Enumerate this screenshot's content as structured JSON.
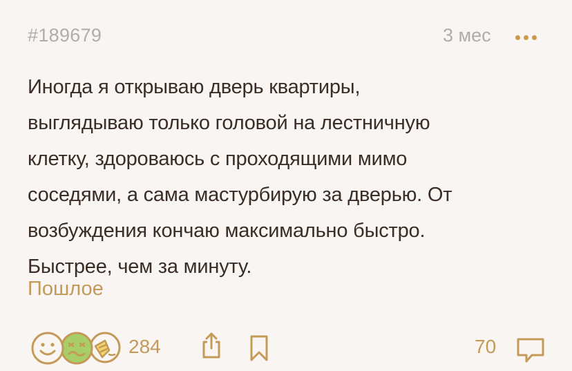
{
  "post": {
    "id": "#189679",
    "age": "3 мес",
    "text_lines": [
      "Иногда я открываю дверь квартиры,",
      "выглядываю только головой на лестничную",
      "клетку, здороваюсь с проходящими мимо",
      "соседями, а сама мастурбирую за дверью. От",
      "возбуждения кончаю максимально быстро.",
      "Быстрее, чем за минуту."
    ],
    "tag": "Пошлое"
  },
  "footer": {
    "reactions_count": "284",
    "comments_count": "70",
    "reaction_icons": [
      "smile-emoji-icon",
      "sick-emoji-icon",
      "facepalm-emoji-icon"
    ]
  },
  "colors": {
    "background": "#f8f5f3",
    "text": "#3a2d26",
    "muted": "#b3aca6",
    "accent": "#c39a57"
  }
}
